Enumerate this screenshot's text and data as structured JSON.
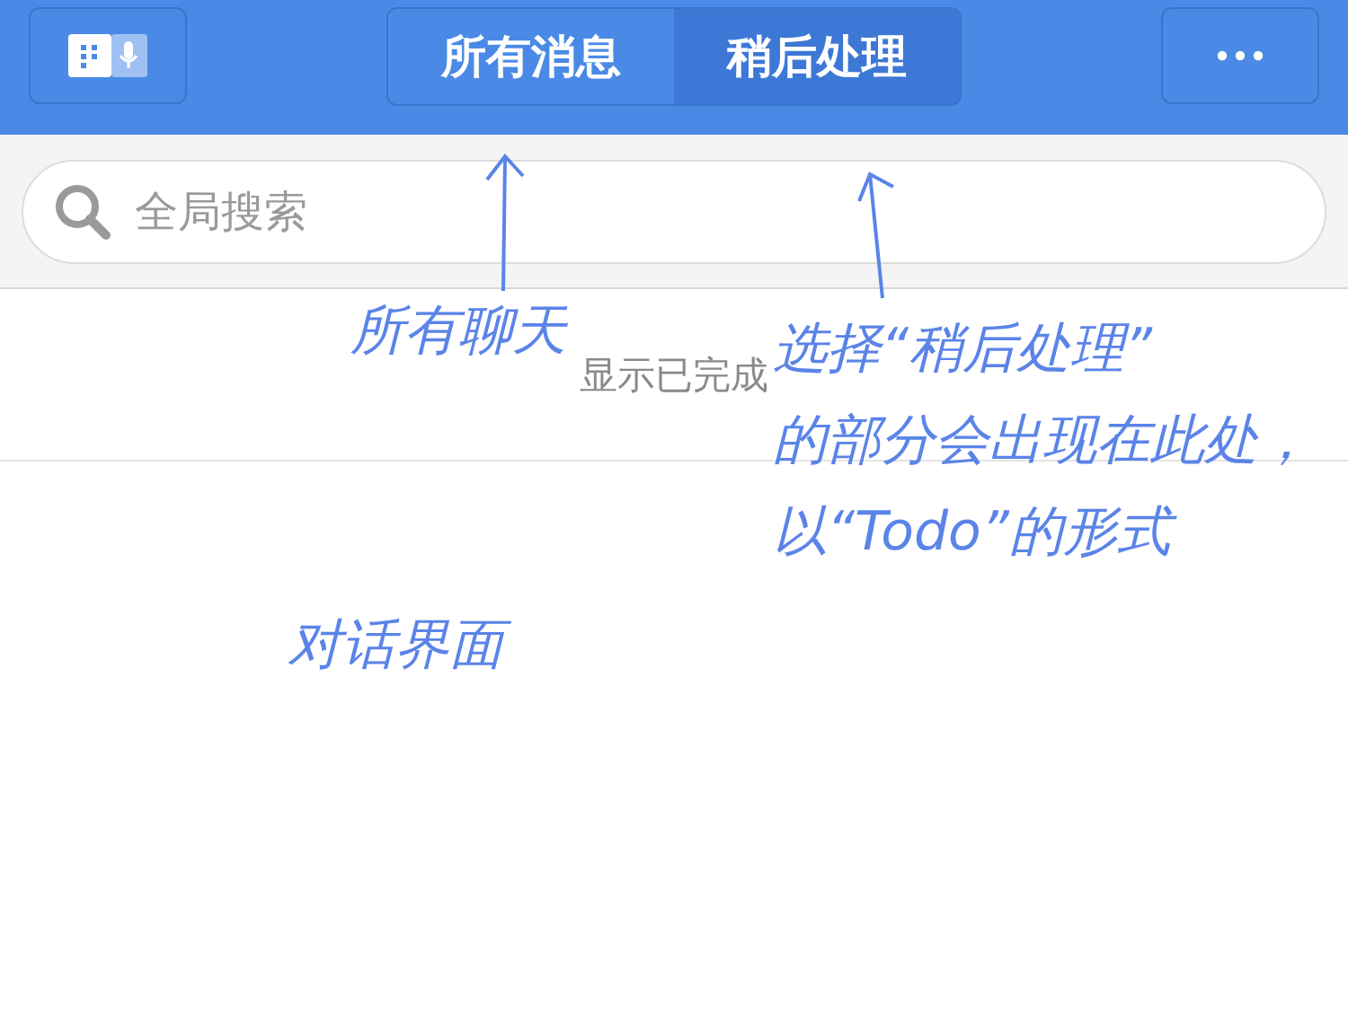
{
  "header": {
    "tabs": [
      {
        "label": "所有消息",
        "selected": false
      },
      {
        "label": "稍后处理",
        "selected": true
      }
    ]
  },
  "search": {
    "placeholder": "全局搜索"
  },
  "show_completed": "显示已完成",
  "annotations": [
    {
      "kind": "note",
      "lines": [
        "所有聊天"
      ]
    },
    {
      "kind": "note",
      "lines": [
        "选择“稍后处理”",
        "的部分会出现在此处，",
        "以“Todo”的形式"
      ]
    },
    {
      "kind": "note",
      "lines": [
        "对话界面"
      ]
    }
  ]
}
